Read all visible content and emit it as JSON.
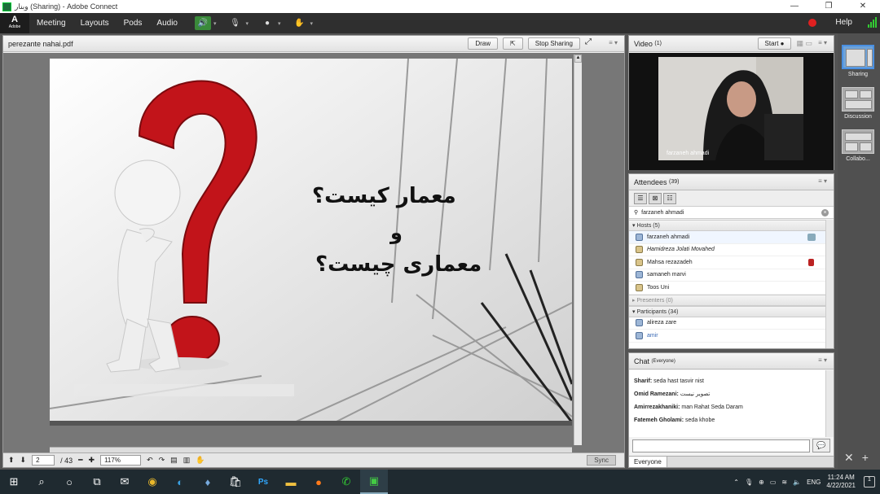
{
  "titlebar": {
    "title": "وبنار (Sharing) - Adobe Connect",
    "minimize": "—",
    "restore": "❐",
    "close": "✕"
  },
  "menubar": {
    "logo": "Adobe",
    "items": [
      "Meeting",
      "Layouts",
      "Pods",
      "Audio"
    ],
    "help": "Help"
  },
  "share": {
    "filename": "perezante nahai.pdf",
    "draw": "Draw",
    "stop_sharing": "Stop Sharing",
    "page": "2",
    "total": "/ 43",
    "zoom": "117%",
    "sync": "Sync",
    "slide": {
      "line1": "معمار کیست؟",
      "line2": "و",
      "line3": "معماری چیست؟"
    }
  },
  "video": {
    "title": "Video",
    "count": "(1)",
    "start": "Start",
    "name": "farzaneh ahmadi"
  },
  "attendees": {
    "title": "Attendees",
    "count": "(39)",
    "me": "farzaneh ahmadi",
    "hosts_label": "Hosts (5)",
    "hosts": [
      "farzaneh ahmadi",
      "Hamidreza Jolati Movahed",
      "Mahsa rezazadeh",
      "samaneh marvi",
      "Toos Uni"
    ],
    "presenters_label": "Presenters (0)",
    "participants_label": "Participants (34)",
    "participants": [
      "alireza zare",
      "amir"
    ]
  },
  "chat": {
    "title": "Chat",
    "scope": "(Everyone)",
    "tab": "Everyone",
    "messages": [
      {
        "sender": "Sharif:",
        "text": "seda hast tasvir nist"
      },
      {
        "sender": "Omid Ramezani:",
        "text": "تصویر نیست"
      },
      {
        "sender": "Amirrezakhaniki:",
        "text": "man Rahat Seda Daram"
      },
      {
        "sender": "Fatemeh Gholami:",
        "text": "seda khobe"
      }
    ]
  },
  "layouts": [
    {
      "label": "Sharing"
    },
    {
      "label": "Discussion"
    },
    {
      "label": "Collabo..."
    }
  ],
  "taskbar": {
    "lang": "ENG",
    "time": "11:24 AM",
    "date": "4/22/2021",
    "notif": "1"
  }
}
